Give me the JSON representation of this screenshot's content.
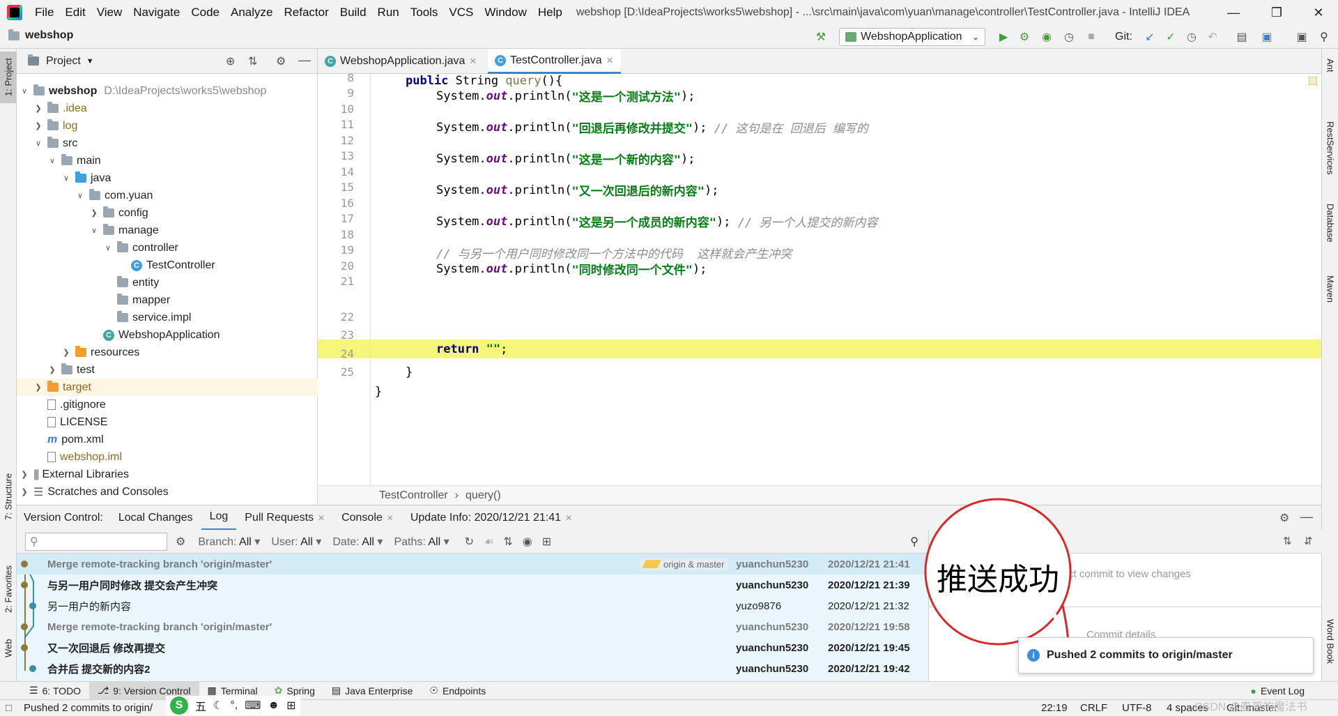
{
  "menubar": {
    "items": [
      "File",
      "Edit",
      "View",
      "Navigate",
      "Code",
      "Analyze",
      "Refactor",
      "Build",
      "Run",
      "Tools",
      "VCS",
      "Window",
      "Help"
    ],
    "title": "webshop [D:\\IdeaProjects\\works5\\webshop] - ...\\src\\main\\java\\com\\yuan\\manage\\controller\\TestController.java - IntelliJ IDEA"
  },
  "navbar": {
    "project": "webshop",
    "run_config": "WebshopApplication",
    "git_label": "Git:"
  },
  "left_stripe": {
    "project": "1: Project",
    "structure": "7: Structure",
    "favorites": "2: Favorites",
    "web": "Web"
  },
  "right_stripe": {
    "ant": "Ant",
    "rest": "RestServices",
    "database": "Database",
    "maven": "Maven",
    "wordbook": "Word Book"
  },
  "project_panel": {
    "title": "Project",
    "tree": [
      {
        "label": "webshop",
        "extra": "D:\\IdeaProjects\\works5\\webshop"
      },
      {
        "label": ".idea"
      },
      {
        "label": "log"
      },
      {
        "label": "src"
      },
      {
        "label": "main"
      },
      {
        "label": "java"
      },
      {
        "label": "com.yuan"
      },
      {
        "label": "config"
      },
      {
        "label": "manage"
      },
      {
        "label": "controller"
      },
      {
        "label": "TestController"
      },
      {
        "label": "entity"
      },
      {
        "label": "mapper"
      },
      {
        "label": "service.impl"
      },
      {
        "label": "WebshopApplication"
      },
      {
        "label": "resources"
      },
      {
        "label": "test"
      },
      {
        "label": "target"
      },
      {
        "label": ".gitignore"
      },
      {
        "label": "LICENSE"
      },
      {
        "label": "pom.xml"
      },
      {
        "label": "webshop.iml"
      },
      {
        "label": "External Libraries"
      },
      {
        "label": "Scratches and Consoles"
      }
    ]
  },
  "editor": {
    "tabs": [
      "WebshopApplication.java",
      "TestController.java"
    ],
    "line_numbers": [
      "8",
      "9",
      "10",
      "11",
      "12",
      "13",
      "14",
      "15",
      "16",
      "17",
      "18",
      "19",
      "20",
      "21",
      "22",
      "23",
      "24",
      "25"
    ],
    "code": {
      "l8_kw": "public",
      "l8_rest": " String ",
      "l8_fn": "query",
      "l8_end": "(){",
      "sys": "System.",
      "out": "out",
      "println": ".println(",
      "l9_str": "\"这是一个测试方法\"",
      "l11_str": "\"回退后再修改并提交\"",
      "l11_cmt": "// 这句是在 回退后 编写的",
      "l13_str": "\"这是一个新的内容\"",
      "l15_str": "\"又一次回退后的新内容\"",
      "l17_str": "\"这是另一个成员的新内容\"",
      "l17_cmt": "// 另一个人提交的新内容",
      "l19_cmt": "// 与另一个用户同时修改同一个方法中的代码  这样就会产生冲突",
      "l20_str": "\"同时修改同一个文件\"",
      "close": ");",
      "l22_kw": "return",
      "l22_str": "\"\"",
      "semi": ";",
      "brace": "}"
    },
    "breadcrumb": [
      "TestController",
      "query()"
    ]
  },
  "vc_panel": {
    "label": "Version Control:",
    "tabs": [
      "Local Changes",
      "Log",
      "Pull Requests",
      "Console",
      "Update Info: 2020/12/21 21:41"
    ],
    "filters": [
      {
        "name": "Branch:",
        "value": "All"
      },
      {
        "name": "User:",
        "value": "All"
      },
      {
        "name": "Date:",
        "value": "All"
      },
      {
        "name": "Paths:",
        "value": "All"
      }
    ],
    "log": [
      {
        "message": "Merge remote-tracking branch 'origin/master'",
        "author": "yuanchun5230",
        "date": "2020/12/21 21:41",
        "refs": "origin & master"
      },
      {
        "message": "与另一用户同时修改 提交会产生冲突",
        "author": "yuanchun5230",
        "date": "2020/12/21 21:39"
      },
      {
        "message": "另一用户的新内容",
        "author": "yuzo9876",
        "date": "2020/12/21 21:32"
      },
      {
        "message": "Merge remote-tracking branch 'origin/master'",
        "author": "yuanchun5230",
        "date": "2020/12/21 19:58"
      },
      {
        "message": "又一次回退后 修改再提交",
        "author": "yuanchun5230",
        "date": "2020/12/21 19:45"
      },
      {
        "message": "合并后 提交新的内容2",
        "author": "yuanchun5230",
        "date": "2020/12/21 19:42"
      }
    ],
    "details_placeholder": "Select commit to view changes",
    "commit_details": "Commit details"
  },
  "notification": {
    "text": "Pushed 2 commits to origin/master"
  },
  "annotation": {
    "text": "推送成功"
  },
  "toolwindows": [
    {
      "label": "6: TODO"
    },
    {
      "label": "9: Version Control"
    },
    {
      "label": "Terminal"
    },
    {
      "label": "Spring"
    },
    {
      "label": "Java Enterprise"
    },
    {
      "label": "Endpoints"
    }
  ],
  "event_log": "Event Log",
  "statusbar": {
    "message": "Pushed 2 commits to origin/",
    "position": "22:19",
    "line_sep": "CRLF",
    "encoding": "UTF-8",
    "indent": "4 spaces",
    "git": "Git: master"
  },
  "ime": {
    "labels": [
      "五"
    ]
  },
  "watermark": "CSDN @春哥的魔法书",
  "colors": {
    "accent": "#4083c9",
    "highlight": "#f5f57a",
    "log_bg": "#eaf6fb",
    "annotation": "#d62a2a"
  }
}
